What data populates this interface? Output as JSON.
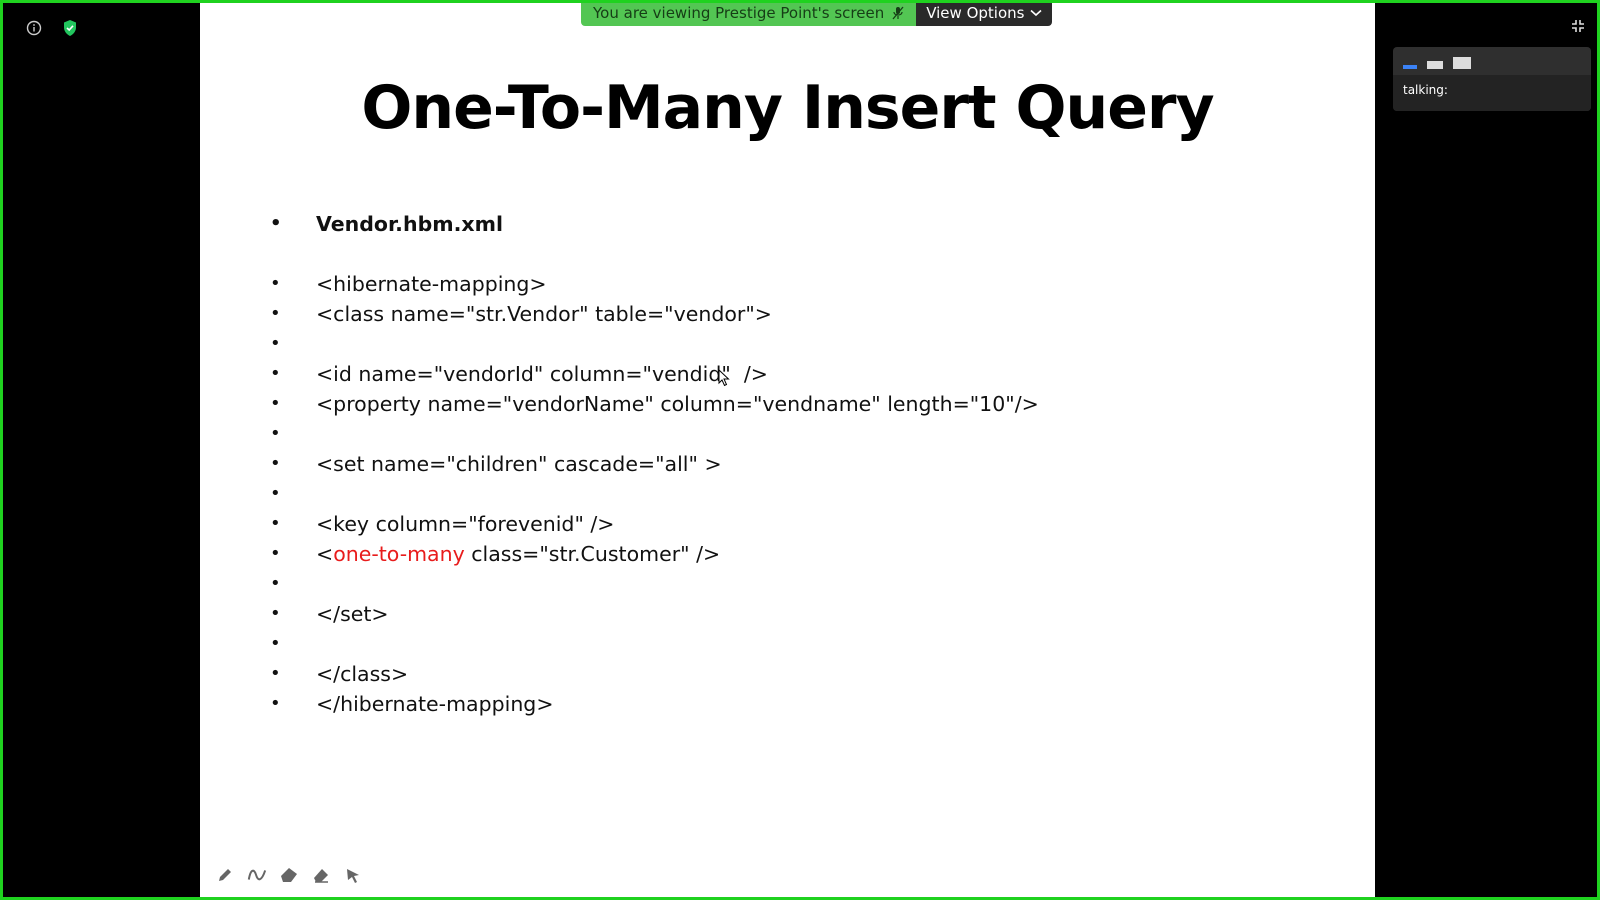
{
  "banner": {
    "viewing_text": "You are viewing Prestige Point's screen",
    "view_options_label": "View Options"
  },
  "slide": {
    "title": "One-To-Many Insert Query",
    "file_label": "Vendor.hbm.xml",
    "lines": [
      "<hibernate-mapping>",
      "<class name=\"str.Vendor\" table=\"vendor\">",
      "",
      "<id name=\"vendorId\" column=\"vendid\"  />",
      "<property name=\"vendorName\" column=\"vendname\" length=\"10\"/>",
      "",
      "<set name=\"children\" cascade=\"all\" >",
      "",
      "<key column=\"forevenid\" />",
      "",
      "",
      "</set>",
      "",
      "</class>",
      "</hibernate-mapping>"
    ],
    "one_to_many_line": {
      "prefix": "<",
      "keyword": "one-to-many",
      "suffix": " class=\"str.Customer\" />"
    }
  },
  "speaker_panel": {
    "talking_label": "talking:"
  },
  "colors": {
    "border": "#1fd21f",
    "banner_bg": "#53c653",
    "keyword_red": "#e81c1c",
    "accent_blue": "#3b82f6"
  },
  "icons": {
    "top_left": [
      "info-icon",
      "shield-check-icon"
    ],
    "top_right": "exit-fullscreen-icon",
    "annotation_tools": [
      "pen-icon",
      "squiggle-icon",
      "stamp-icon",
      "eraser-icon",
      "pointer-icon"
    ]
  }
}
